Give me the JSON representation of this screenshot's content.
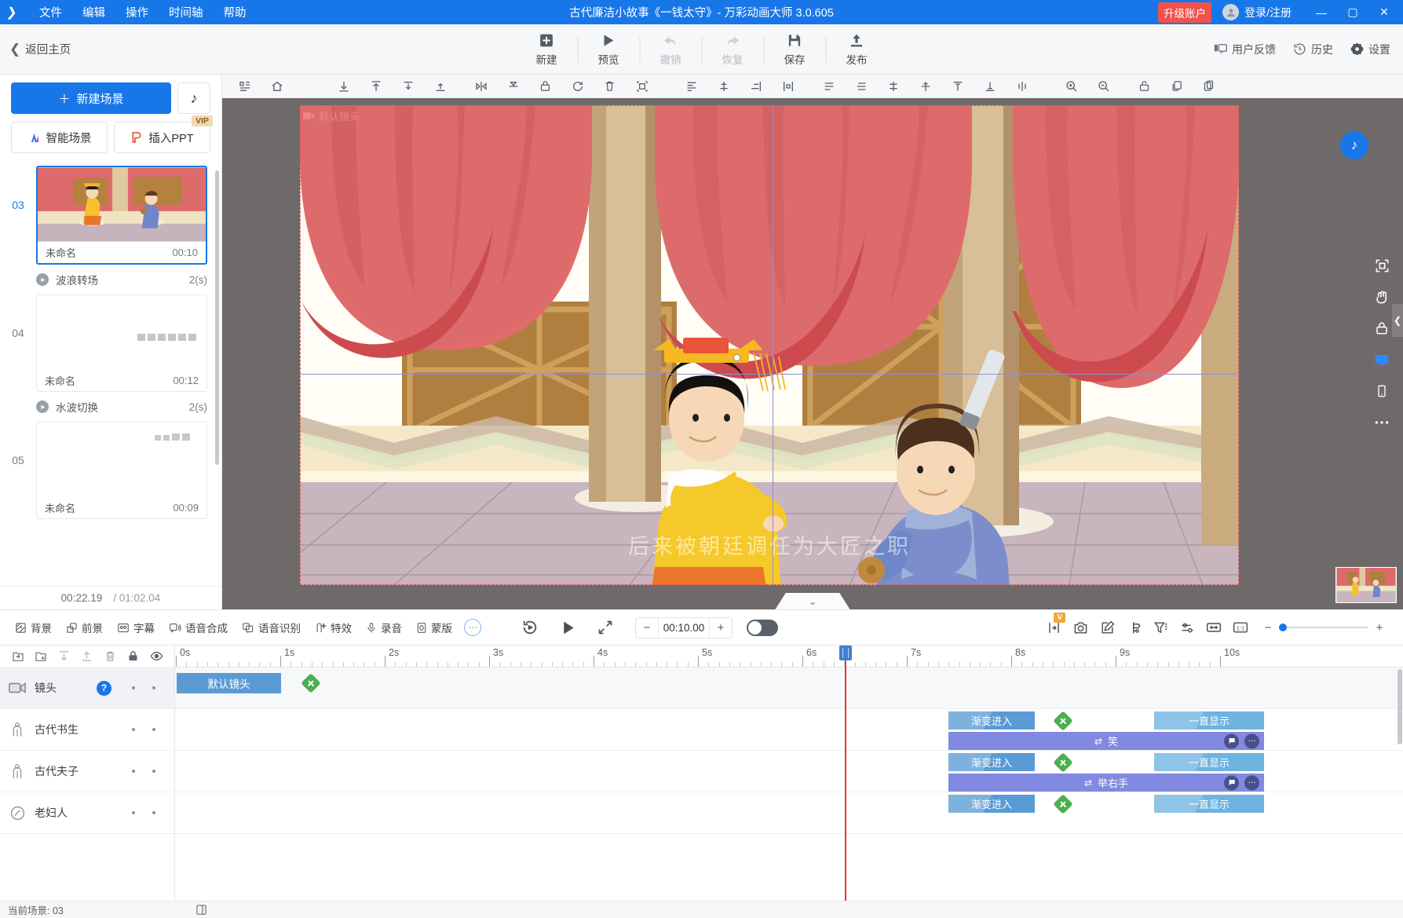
{
  "titlebar": {
    "menu": [
      "文件",
      "编辑",
      "操作",
      "时间轴",
      "帮助"
    ],
    "app_title": "古代廉洁小故事《一钱太守》- 万彩动画大师 3.0.605",
    "upgrade_label": "升级账户",
    "login_label": "登录/注册",
    "minimize": "—",
    "maximize": "▢",
    "close": "✕",
    "accent_color": "#1877e8",
    "upgrade_color": "#f2514c"
  },
  "toolbar": {
    "back_home": "返回主页",
    "buttons": [
      {
        "label": "新建",
        "icon": "plus-square-icon",
        "disabled": false
      },
      {
        "label": "预览",
        "icon": "play-icon",
        "disabled": false
      },
      {
        "label": "撤销",
        "icon": "undo-icon",
        "disabled": true
      },
      {
        "label": "恢复",
        "icon": "redo-icon",
        "disabled": true
      },
      {
        "label": "保存",
        "icon": "save-icon",
        "disabled": false
      },
      {
        "label": "发布",
        "icon": "publish-icon",
        "disabled": false
      }
    ],
    "right": [
      {
        "label": "用户反馈",
        "icon": "feedback-icon"
      },
      {
        "label": "历史",
        "icon": "history-icon"
      },
      {
        "label": "设置",
        "icon": "gear-icon"
      }
    ]
  },
  "scene_panel": {
    "new_scene": "新建场景",
    "music_icon": "music-note-icon",
    "smart_scene": "智能场景",
    "insert_ppt": "插入PPT",
    "vip_badge": "VIP",
    "scenes": [
      {
        "num": "03",
        "name": "未命名",
        "duration": "00:10",
        "selected": true,
        "thumb": "palace"
      },
      {
        "num": "04",
        "name": "未命名",
        "duration": "00:12",
        "selected": false,
        "thumb": "text"
      },
      {
        "num": "05",
        "name": "未命名",
        "duration": "00:09",
        "selected": false,
        "thumb": "text2"
      }
    ],
    "transitions": [
      {
        "name": "波浪转场",
        "duration": "2(s)"
      },
      {
        "name": "水波切换",
        "duration": "2(s)"
      }
    ],
    "current_time": "00:22.19",
    "separator": "/",
    "total_time": "01:02.04"
  },
  "canvas": {
    "camera_label": "默认镜头",
    "watermark": "后来被朝廷调任为大匠之职",
    "toolbar_icons": [
      "layout-icon",
      "home-icon",
      "align-bottom-icon",
      "align-top-icon",
      "distribute-v-icon",
      "align-middle-icon",
      "flip-h-icon",
      "flip-v-icon",
      "lock-icon",
      "rotate-icon",
      "delete-icon",
      "group-icon",
      "align-left-icon",
      "align-center-h-icon",
      "align-right-icon",
      "distribute-h-icon",
      "order-icon",
      "align-justify-icon",
      "spacing-icon",
      "center-v-icon",
      "align-v-top-icon",
      "align-v-bottom-icon",
      "distribute-spacing-icon",
      "zoom-in-icon",
      "zoom-out-icon",
      "lock-canvas-icon",
      "copy-icon",
      "paste-icon"
    ],
    "right_tools": [
      "fit-screen-icon",
      "hand-icon",
      "lock-icon",
      "desktop-icon",
      "mobile-icon",
      "more-icon"
    ],
    "collapse_icon": "chevron-left-icon",
    "music_fab": "music-note-icon",
    "drag_handle": "chevron-down-icon"
  },
  "midbar": {
    "items": [
      {
        "label": "背景",
        "icon": "background-icon"
      },
      {
        "label": "前景",
        "icon": "foreground-icon"
      },
      {
        "label": "字幕",
        "icon": "subtitle-icon"
      },
      {
        "label": "语音合成",
        "icon": "tts-icon"
      },
      {
        "label": "语音识别",
        "icon": "asr-icon"
      },
      {
        "label": "特效",
        "icon": "effects-icon"
      },
      {
        "label": "录音",
        "icon": "microphone-icon"
      },
      {
        "label": "蒙版",
        "icon": "mask-icon"
      }
    ],
    "more_label": "⋯",
    "center_icons": [
      "replay-icon",
      "play-icon",
      "fullscreen-icon"
    ],
    "duration_value": "00:10.00",
    "minus": "−",
    "plus": "+",
    "right_icons": [
      "fit-width-icon",
      "camera-icon",
      "edit-icon",
      "signpost-icon",
      "filter-icon",
      "settings-sliders-icon",
      "width-icon",
      "ratio-1-1-icon"
    ],
    "vip_flag": "V",
    "zoom_out": "−",
    "zoom_in": "+"
  },
  "timeline": {
    "tools": [
      "open-folder-icon",
      "new-folder-icon",
      "move-down-icon",
      "move-up-icon",
      "delete-icon",
      "lock-icon",
      "eye-icon"
    ],
    "ruler_labels": [
      "0s",
      "1s",
      "2s",
      "3s",
      "4s",
      "5s",
      "6s",
      "7s",
      "8s",
      "9s",
      "10s"
    ],
    "tracks": [
      {
        "name": "镜头",
        "icon": "camera-track-icon",
        "help": "?",
        "selected": true
      },
      {
        "name": "古代书生",
        "icon": "person-icon",
        "help": "",
        "selected": false
      },
      {
        "name": "古代夫子",
        "icon": "person-icon",
        "help": "",
        "selected": false
      },
      {
        "name": "老妇人",
        "icon": "circle-person-icon",
        "help": "",
        "selected": false
      }
    ],
    "camera_clip": "默认镜头",
    "clips": [
      {
        "track": 1,
        "enter": "渐变进入",
        "show": "一直显示",
        "action": "笑"
      },
      {
        "track": 2,
        "enter": "渐变进入",
        "show": "一直显示",
        "action": "举右手"
      },
      {
        "track": 3,
        "enter": "渐变进入",
        "show": "一直显示",
        "action": ""
      }
    ],
    "action_icons": {
      "loop": "⇄",
      "comment": "comment-icon",
      "more": "⋯"
    },
    "playhead_time": "6.4s"
  },
  "statusbar": {
    "current_scene": "当前场景: 03",
    "icon": "panel-icon"
  }
}
